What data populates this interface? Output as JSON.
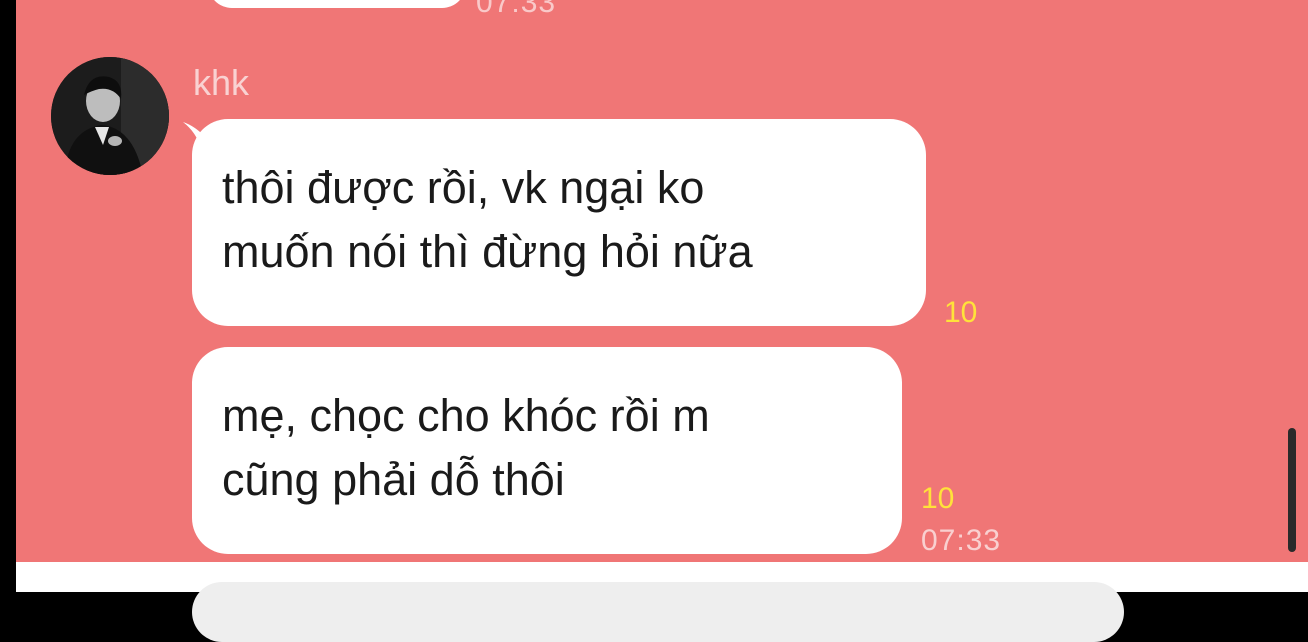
{
  "previous": {
    "time": "07:33"
  },
  "sender": {
    "name": "khk"
  },
  "messages": [
    {
      "lines": [
        "thôi được rồi, vk ngại ko",
        "muốn nói thì đừng hỏi nữa"
      ],
      "read": "10"
    },
    {
      "lines": [
        "mẹ, chọc cho khóc rồi m",
        "cũng phải dỗ thôi"
      ],
      "read": "10",
      "time": "07:33"
    }
  ],
  "colors": {
    "chat_bg": "#f07676",
    "read_count": "#ffe23a",
    "bubble": "#ffffff"
  },
  "icons": {
    "avatar": "profile-photo"
  },
  "input": {
    "placeholder": ""
  }
}
